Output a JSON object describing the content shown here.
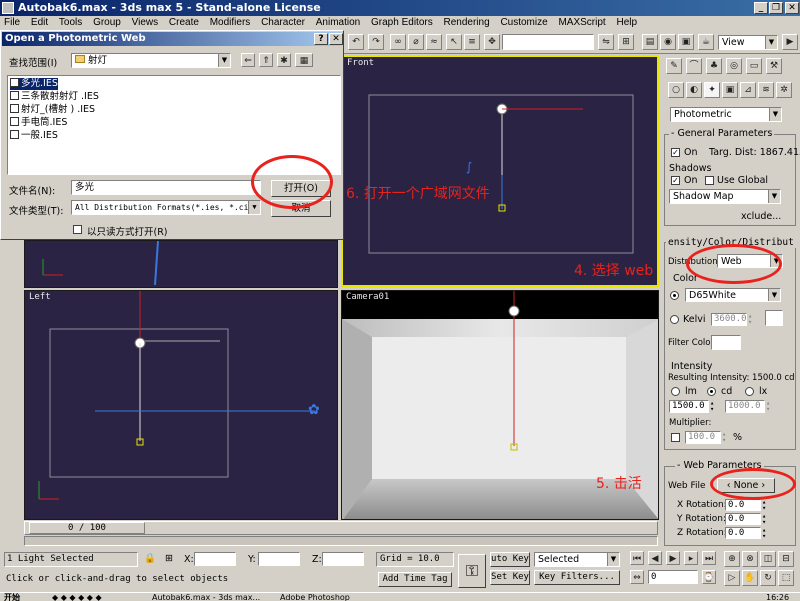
{
  "window": {
    "title": "Autobak6.max - 3ds max 5 - Stand-alone License",
    "controls": [
      "_",
      "❐",
      "✕"
    ]
  },
  "menu": [
    "File",
    "Edit",
    "Tools",
    "Group",
    "Views",
    "Create",
    "Modifiers",
    "Character",
    "Animation",
    "Graph Editors",
    "Rendering",
    "Customize",
    "MAXScript",
    "Help"
  ],
  "toolbar": {
    "viewport_select": "View"
  },
  "dialog": {
    "title": "Open a Photometric Web",
    "lookin_label": "查找范围(I)",
    "lookin_value": "射灯",
    "files": [
      "多光.IES",
      "三条散射射灯 .IES",
      "射灯_(槽射 ) .IES",
      "手电筒.IES",
      "一般.IES"
    ],
    "filename_label": "文件名(N):",
    "filename_value": "多光",
    "filetype_label": "文件类型(T):",
    "filetype_value": "All Distribution Formats(*.ies, *.cib",
    "readonly_label": "以只读方式打开(R)",
    "open_button": "打开(O)",
    "cancel_button": "取消"
  },
  "viewports": {
    "front": "Front",
    "left": "Left",
    "camera": "Camera01"
  },
  "annotations": {
    "step6": "6. 打开一个广域网文件",
    "step4": "4. 选择 web",
    "step5": "5. 击活"
  },
  "cmdpanel": {
    "dropdown": "Photometric",
    "general": {
      "title": "General Parameters",
      "on_label": "On",
      "targ_dist": "Targ. Dist: 1867.415",
      "shadows_label": "Shadows",
      "shadows_on": "On",
      "use_global": "Use Global",
      "shadow_type": "Shadow Map",
      "exclude": "xclude..."
    },
    "intensity_rollout": {
      "title": "ensity/Color/Distribut",
      "distribution_label": "Distribution:",
      "distribution_value": "Web",
      "color_label": "Color",
      "color_preset": "D65White",
      "kelvin_label": "Kelvi",
      "kelvin_value": "3600.0",
      "filter_label": "Filter Color:",
      "intensity_label": "Intensity",
      "resulting": "Resulting Intensity: 1500.0 cd",
      "lm": "lm",
      "cd": "cd",
      "lx": "lx",
      "value1": "1500.0",
      "value2": "1000.0",
      "multiplier_label": "Multiplier:",
      "multiplier_value": "100.0",
      "percent": "%"
    },
    "web": {
      "title": "Web Parameters",
      "file_label": "Web File",
      "file_button": "None",
      "xrot_label": "X Rotation:",
      "yrot_label": "Y Rotation:",
      "zrot_label": "Z Rotation:",
      "xrot": "0.0",
      "yrot": "0.0",
      "zrot": "0.0"
    }
  },
  "timeline": {
    "frame": "0 / 100"
  },
  "status": {
    "selected": "1 Light Selected",
    "prompt": "Click or click-and-drag to select objects",
    "x_label": "X:",
    "y_label": "Y:",
    "z_label": "Z:",
    "grid": "Grid = 10.0",
    "auto_key": "uto Key",
    "set_key": "Set Key",
    "selected_dd": "Selected",
    "key_filters": "Key Filters...",
    "add_time_tag": "Add Time Tag",
    "frame_field": "0"
  },
  "taskbar": {
    "start": "开始",
    "items": [
      "Autobak6.max - 3ds max...",
      "Adobe Photoshop"
    ],
    "clock": "16:26"
  }
}
